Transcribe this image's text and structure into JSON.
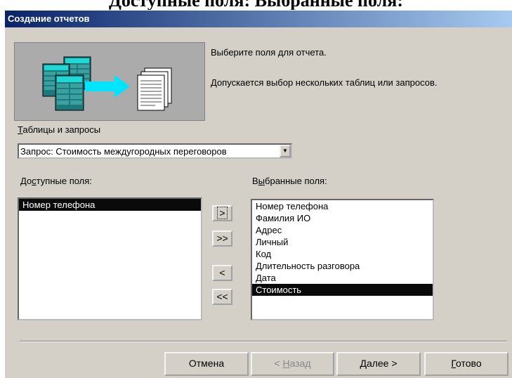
{
  "heading": "Доступные поля:  Выбранные поля:",
  "window": {
    "title": "Создание отчетов"
  },
  "description": {
    "line1": "Выберите поля для отчета.",
    "line2": "Допускается выбор нескольких таблиц или запросов."
  },
  "tables": {
    "label_mnemonic": "Т",
    "label_rest": "аблицы и запросы",
    "selected": "Запрос: Стоимость междугородных переговоров"
  },
  "available": {
    "label_pre": "До",
    "label_mnemonic": "с",
    "label_post": "тупные поля:",
    "items": [
      "Номер телефона"
    ],
    "selected_index": 0
  },
  "chosen": {
    "label_pre": "В",
    "label_mnemonic": "ы",
    "label_post": "бранные поля:",
    "items": [
      "Номер телефона",
      "Фамилия ИО",
      "Адрес",
      "Личный",
      "Код",
      "Длительность разговора",
      "Дата",
      "Стоимость"
    ],
    "selected_index": 7
  },
  "move_buttons": {
    "add_one": ">",
    "add_all": ">>",
    "remove_one": "<",
    "remove_all": "<<"
  },
  "buttons": {
    "cancel": "Отмена",
    "back_pre": "< ",
    "back_mnemonic": "Н",
    "back_post": "азад",
    "next_mnemonic": "Д",
    "next_post": "алее >",
    "finish_mnemonic": "Г",
    "finish_post": "отово"
  },
  "colors": {
    "titlebar_start": "#0a246a",
    "titlebar_end": "#a6caf0",
    "dialog_bg": "#d4d0c8",
    "selection": "#0a0a0a"
  }
}
